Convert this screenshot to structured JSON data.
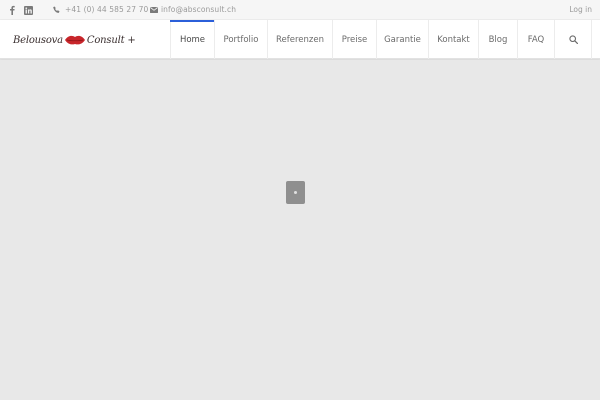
{
  "topbar": {
    "facebook_icon": "facebook-icon",
    "linkedin_icon": "linkedin-icon",
    "phone_icon": "phone-icon",
    "phone": "+41 (0) 44 585 27 70",
    "mail_icon": "mail-icon",
    "email": "info@absconsult.ch",
    "login": "Log in"
  },
  "header": {
    "logo": {
      "part1": "Belousova",
      "part2": "Consult +"
    },
    "nav": [
      {
        "label": "Home",
        "active": true
      },
      {
        "label": "Portfolio",
        "active": false
      },
      {
        "label": "Referenzen",
        "active": false
      },
      {
        "label": "Preise",
        "active": false
      },
      {
        "label": "Garantie",
        "active": false
      },
      {
        "label": "Kontakt",
        "active": false
      },
      {
        "label": "Blog",
        "active": false
      },
      {
        "label": "FAQ",
        "active": false
      }
    ],
    "search_icon": "search-icon"
  },
  "colors": {
    "accent": "#2b5fd9",
    "page_background": "#e8e8e8",
    "loader": "#8f8f8f",
    "logo_lips": "#c8262b"
  }
}
